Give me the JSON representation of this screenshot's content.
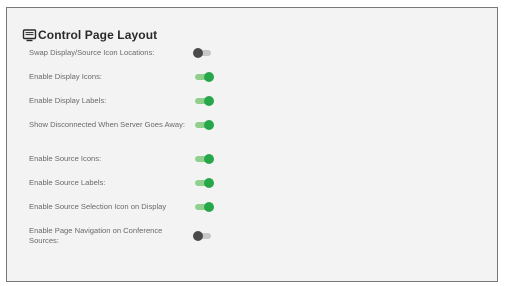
{
  "panel": {
    "title": "Control Page Layout",
    "title_icon": "monitor-icon"
  },
  "settings": [
    {
      "label": "Swap Display/Source Icon Locations:",
      "enabled": false
    },
    {
      "label": "Enable Display Icons:",
      "enabled": true
    },
    {
      "label": "Enable Display Labels:",
      "enabled": true
    },
    {
      "label": "Show Disconnected When Server Goes Away:",
      "enabled": true
    },
    {
      "label": "Enable Source Icons:",
      "enabled": true
    },
    {
      "label": "Enable Source Labels:",
      "enabled": true
    },
    {
      "label": "Enable Source Selection Icon on Display",
      "enabled": true
    },
    {
      "label": "Enable Page Navigation on Conference Sources:",
      "enabled": false
    }
  ],
  "colors": {
    "toggle_on": "#27a64a",
    "toggle_off": "#4a4a4a"
  }
}
